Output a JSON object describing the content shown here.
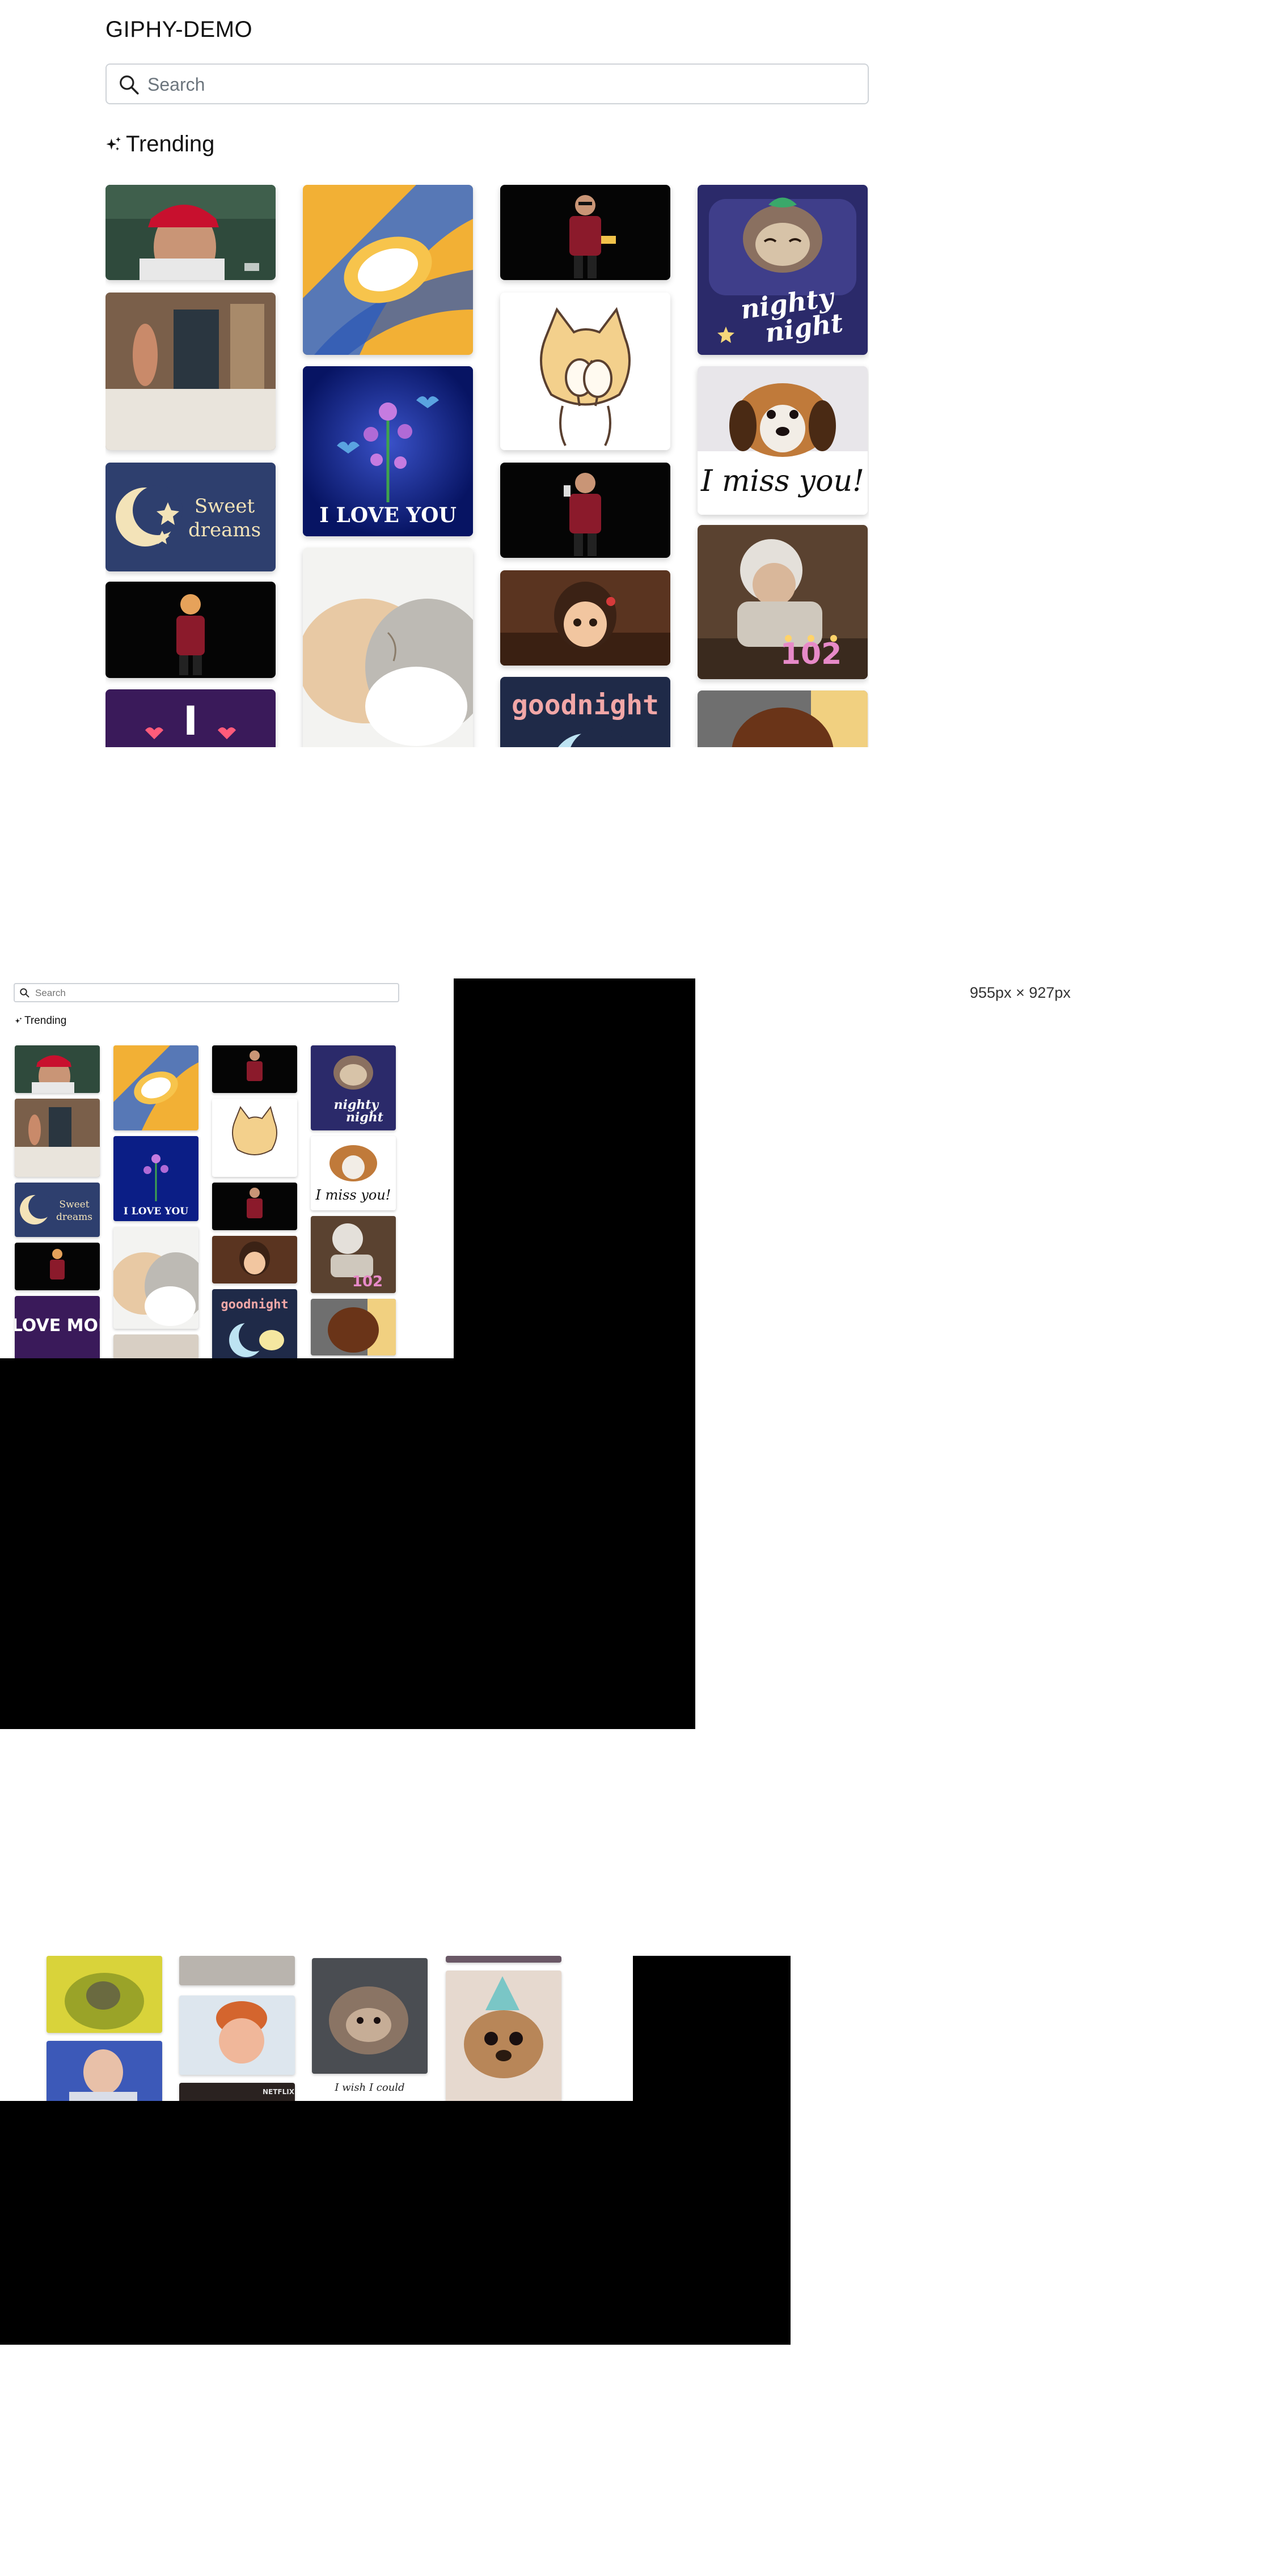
{
  "app": {
    "title": "GIPHY-DEMO"
  },
  "search": {
    "placeholder": "Search"
  },
  "section": {
    "title": "Trending"
  },
  "gifs": {
    "sweet_dreams": {
      "line1": "Sweet",
      "line2": "dreams"
    },
    "i_love_you": "I LOVE YOU",
    "nighty_night": {
      "line1": "nighty",
      "line2": "night"
    },
    "miss_you": "I miss you!",
    "goodnight": "goodnight",
    "i_love_mom": "I LOVE MOM",
    "i_wish_i_could": "I wish I could",
    "netflix": "NETFLIX",
    "candles": "102"
  },
  "preview": {
    "dimensions": "955px × 927px",
    "search_placeholder": "Search",
    "section_title": "Trending"
  },
  "icons": {
    "search": "magnifier-icon",
    "trending": "sparkle-icon"
  },
  "colors": {
    "border": "#cfd3d8",
    "placeholder": "#6c757d",
    "overlay": "#000000"
  }
}
